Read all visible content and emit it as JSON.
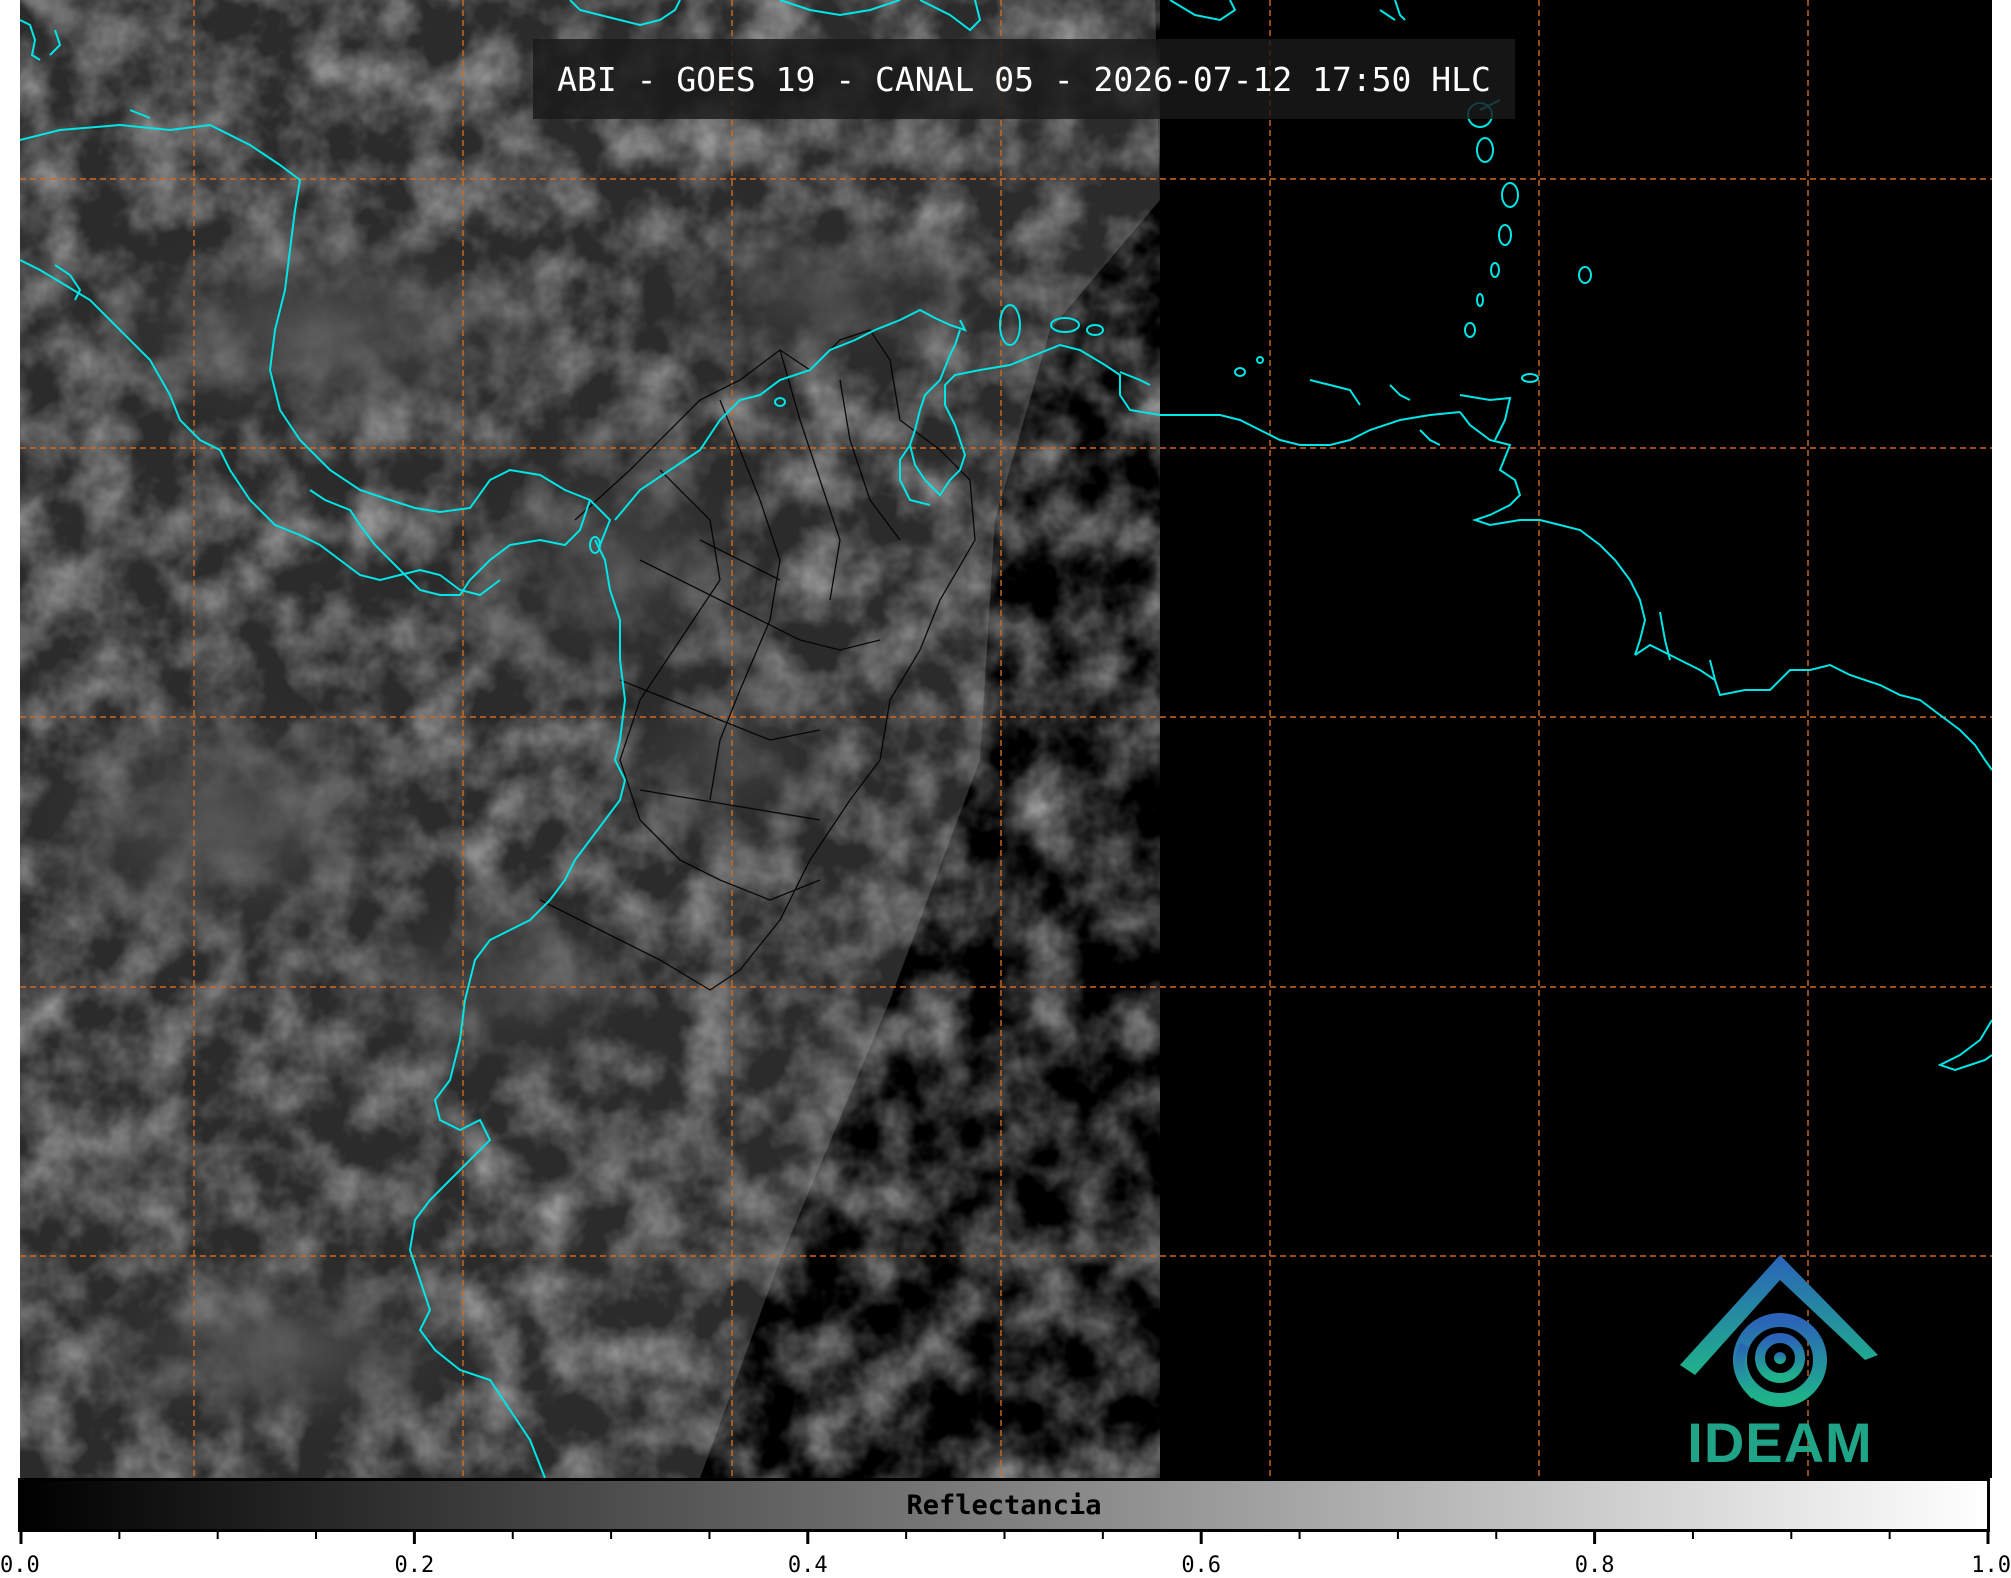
{
  "title": "ABI - GOES 19 - CANAL 05 - 2026-07-12 17:50 HLC",
  "logo": {
    "text": "IDEAM",
    "icon": "ideam-swirl-logo-icon"
  },
  "colorbar": {
    "label": "Reflectancia",
    "range": [
      0.0,
      1.0
    ],
    "tick_labels": [
      "0.0",
      "0.2",
      "0.4",
      "0.6",
      "0.8",
      "1.0"
    ],
    "major_ticks": [
      0.0,
      0.2,
      0.4,
      0.6,
      0.8,
      1.0
    ],
    "minor_ticks": [
      0.05,
      0.1,
      0.15,
      0.25,
      0.3,
      0.35,
      0.45,
      0.5,
      0.55,
      0.65,
      0.7,
      0.75,
      0.85,
      0.9,
      0.95
    ],
    "colormap_start": "#000000",
    "colormap_end": "#ffffff"
  },
  "colors": {
    "coastline": "#00e5e5",
    "gridline": "#d2691e",
    "borders": "#000000",
    "background": "#000000"
  }
}
